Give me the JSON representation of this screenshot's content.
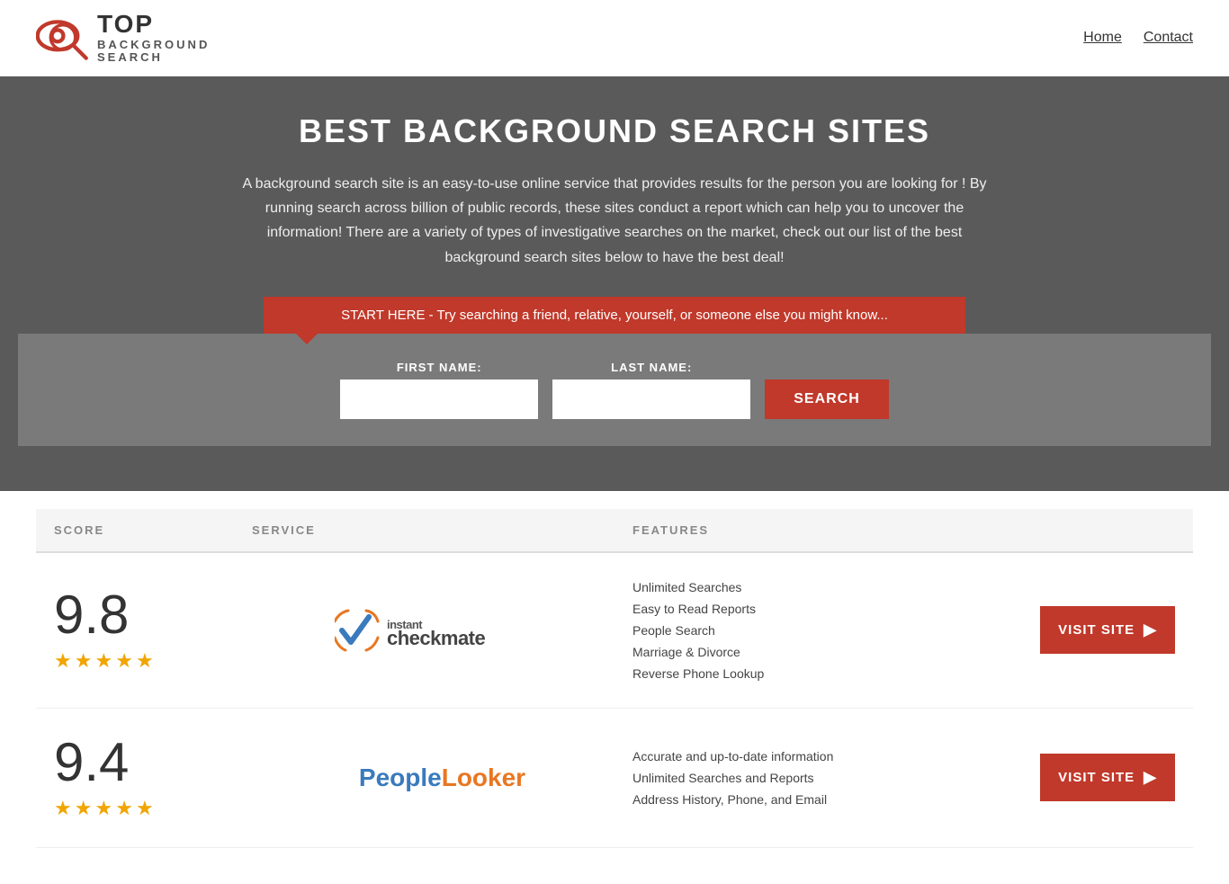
{
  "header": {
    "logo_top": "TOP",
    "logo_bottom": "BACKGROUND\nSEARCH",
    "nav_home": "Home",
    "nav_contact": "Contact"
  },
  "hero": {
    "title": "BEST BACKGROUND SEARCH SITES",
    "description": "A background search site is an easy-to-use online service that provides results  for the person you are looking for ! By  running  search across billion of public records, these sites conduct  a report which can help you to uncover the information! There are a variety of types of investigative searches on the market, check out our  list of the best background search sites below to have the best deal!"
  },
  "search": {
    "banner_text": "START HERE - Try searching a friend, relative, yourself, or someone else you might know...",
    "first_name_label": "FIRST NAME:",
    "last_name_label": "LAST NAME:",
    "button_label": "SEARCH"
  },
  "table": {
    "headers": [
      "SCORE",
      "SERVICE",
      "FEATURES",
      ""
    ],
    "rows": [
      {
        "score": "9.8",
        "stars": 4.5,
        "service_name": "Instant Checkmate",
        "features": [
          "Unlimited Searches",
          "Easy to Read Reports",
          "People Search",
          "Marriage & Divorce",
          "Reverse Phone Lookup"
        ],
        "visit_label": "VISIT SITE"
      },
      {
        "score": "9.4",
        "stars": 4.5,
        "service_name": "PeopleLooker",
        "features": [
          "Accurate and up-to-date information",
          "Unlimited Searches and Reports",
          "Address History, Phone, and Email"
        ],
        "visit_label": "VISIT SITE"
      }
    ]
  }
}
